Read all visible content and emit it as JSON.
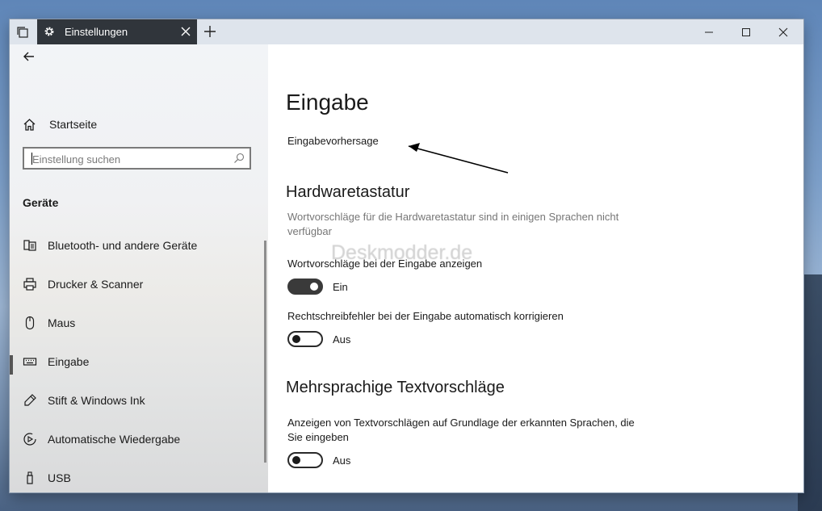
{
  "titlebar": {
    "tab_title": "Einstellungen",
    "icons": {
      "tab_manager": "tabs-icon",
      "gear": "gear-icon",
      "close_tab": "close-icon",
      "new_tab": "plus-icon",
      "minimize": "minimize-icon",
      "maximize": "maximize-icon",
      "close": "close-icon"
    }
  },
  "sidebar": {
    "home_label": "Startseite",
    "search_placeholder": "Einstellung suchen",
    "section_label": "Geräte",
    "items": [
      {
        "label": "Bluetooth- und andere Geräte",
        "icon": "bluetooth-devices-icon",
        "selected": false
      },
      {
        "label": "Drucker & Scanner",
        "icon": "printer-icon",
        "selected": false
      },
      {
        "label": "Maus",
        "icon": "mouse-icon",
        "selected": false
      },
      {
        "label": "Eingabe",
        "icon": "keyboard-icon",
        "selected": true
      },
      {
        "label": "Stift & Windows Ink",
        "icon": "pen-icon",
        "selected": false
      },
      {
        "label": "Automatische Wiedergabe",
        "icon": "autoplay-icon",
        "selected": false
      },
      {
        "label": "USB",
        "icon": "usb-icon",
        "selected": false
      }
    ]
  },
  "content": {
    "title": "Eingabe",
    "link": "Eingabevorhersage",
    "watermark": "Deskmodder.de",
    "hardware": {
      "heading": "Hardwaretastatur",
      "note": "Wortvorschläge für die Hardwaretastatur sind in einigen Sprachen nicht verfügbar",
      "settings": [
        {
          "label": "Wortvorschläge bei der Eingabe anzeigen",
          "on": true,
          "state": "Ein"
        },
        {
          "label": "Rechtschreibfehler bei der Eingabe automatisch korrigieren",
          "on": false,
          "state": "Aus"
        }
      ]
    },
    "multilingual": {
      "heading": "Mehrsprachige Textvorschläge",
      "settings": [
        {
          "label": "Anzeigen von Textvorschlägen auf Grundlage der erkannten Sprachen, die Sie eingeben",
          "on": false,
          "state": "Aus"
        }
      ]
    }
  }
}
